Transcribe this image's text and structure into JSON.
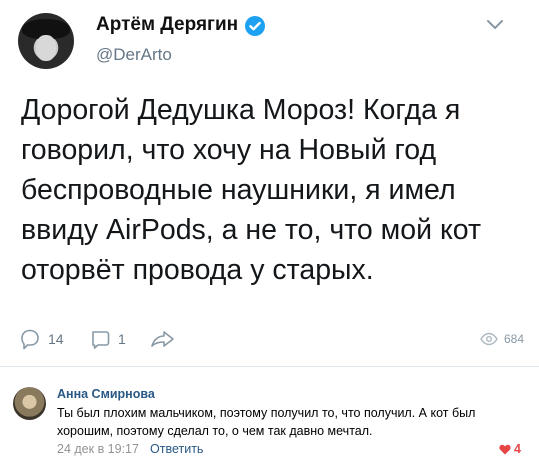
{
  "tweet": {
    "author_name": "Артём Дерягин",
    "author_handle": "@DerArto",
    "verified": true,
    "text": "Дорогой Дедушка Мороз! Когда я говорил, что хочу на Новый год беспроводные наушники, я имел ввиду AirPods, а не то, что мой кот оторвёт провода у старых.",
    "reply_count": "14",
    "retweet_count": "1",
    "views": "684",
    "icons": [
      "verified-icon",
      "chevron-down-icon",
      "reply-icon",
      "retweet-icon",
      "share-icon",
      "eye-icon"
    ]
  },
  "comment": {
    "author": "Анна Смирнова",
    "text": "Ты был плохим мальчиком, поэтому получил то, что получил. А кот был хорошим, поэтому сделал то, о чем так давно мечтал.",
    "date": "24 дек в 19:17",
    "reply_label": "Ответить",
    "likes": "4"
  },
  "colors": {
    "verified": "#1da1f2",
    "link": "#2a5885",
    "like": "#e64646",
    "muted": "#657786"
  }
}
